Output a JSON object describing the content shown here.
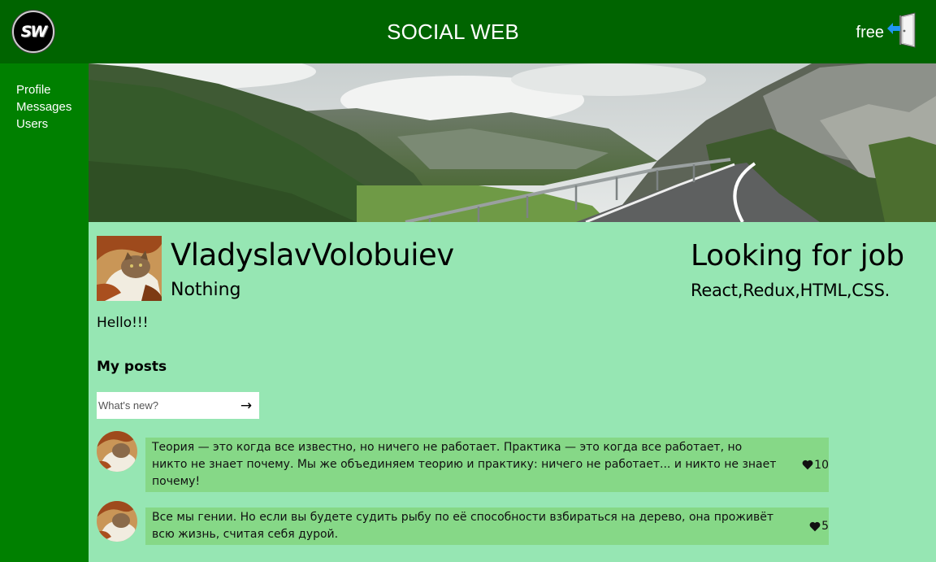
{
  "header": {
    "logo_text": "SW",
    "title": "SOCIAL WEB",
    "login_text": "free",
    "login_icon": "door-exit-icon"
  },
  "sidebar": {
    "items": [
      {
        "label": "Profile"
      },
      {
        "label": "Messages"
      },
      {
        "label": "Users"
      }
    ]
  },
  "profile": {
    "name": "VladyslavVolobuiev",
    "status": "Nothing",
    "job_title": "Looking for job",
    "job_skills": "React,Redux,HTML,CSS.",
    "about": "Hello!!!"
  },
  "posts": {
    "title": "My posts",
    "input_placeholder": "What's new?",
    "send_icon": "→",
    "items": [
      {
        "text": "Теория — это когда все известно, но ничего не работает. Практика — это когда все работает, но никто не знает почему. Мы же объединяем теорию и практику: ничего не работает... и никто не знает почему!",
        "likes": "10"
      },
      {
        "text": "Все мы гении. Но если вы будете судить рыбу по её способности взбираться на дерево, она проживёт всю жизнь, считая себя дурой.",
        "likes": "5"
      }
    ]
  },
  "colors": {
    "header_bg": "#006400",
    "sidebar_bg": "#008000",
    "content_bg": "#96e6b3",
    "post_bg": "#86d887"
  }
}
